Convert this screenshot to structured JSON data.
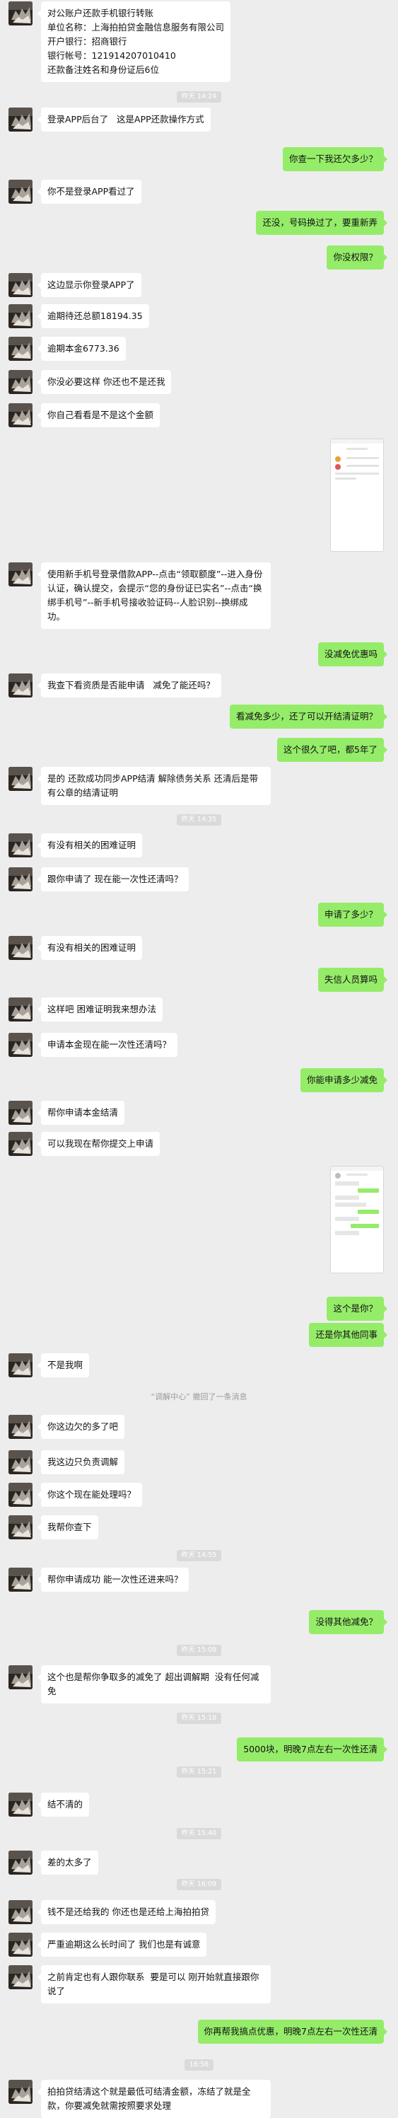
{
  "messages": [
    {
      "kind": "left",
      "text": "对公账户还款手机银行转账\n单位名称：上海拍拍贷金融信息服务有限公司\n开户银行：招商银行\n银行帐号：121914207010410\n还款备注姓名和身份证后6位"
    },
    {
      "kind": "time",
      "text": "昨天 14:24"
    },
    {
      "kind": "left",
      "text": "登录APP后台了   这是APP还款操作方式"
    },
    {
      "kind": "right",
      "text": "你查一下我还欠多少？"
    },
    {
      "kind": "left",
      "text": "你不是登录APP看过了"
    },
    {
      "kind": "right",
      "text": "还没，号码换过了，要重新弄"
    },
    {
      "kind": "right",
      "text": "你没权限？"
    },
    {
      "kind": "left",
      "text": "这边显示你登录APP了"
    },
    {
      "kind": "left",
      "text": "逾期待还总额18194.35"
    },
    {
      "kind": "left",
      "text": "逾期本金6773.36"
    },
    {
      "kind": "left",
      "text": "你没必要这样 你还也不是还我"
    },
    {
      "kind": "left",
      "text": "你自己看看是不是这个金额"
    },
    {
      "kind": "image",
      "variant": "app-account"
    },
    {
      "kind": "left",
      "text": "使用新手机号登录借款APP--点击“领取额度”--进入身份认证，确认提交，会提示“您的身份证已实名”--点击“换绑手机号”--新手机号接收验证码--人脸识别--换绑成功。"
    },
    {
      "kind": "right",
      "text": "没减免优惠吗"
    },
    {
      "kind": "left",
      "text": "我查下看资质是否能申请   减免了能还吗？"
    },
    {
      "kind": "right",
      "text": "看减免多少，还了可以开结清证明？"
    },
    {
      "kind": "right",
      "text": "这个很久了吧，都5年了"
    },
    {
      "kind": "left",
      "text": "是的 还款成功同步APP结清 解除债务关系 还清后是带有公章的结清证明"
    },
    {
      "kind": "time",
      "text": "昨天 14:35"
    },
    {
      "kind": "left",
      "text": "有没有相关的困难证明"
    },
    {
      "kind": "left",
      "text": "跟你申请了 现在能一次性还清吗？"
    },
    {
      "kind": "right",
      "text": "申请了多少？"
    },
    {
      "kind": "left",
      "text": "有没有相关的困难证明"
    },
    {
      "kind": "right",
      "text": "失信人员算吗"
    },
    {
      "kind": "left",
      "text": "这样吧 困难证明我来想办法"
    },
    {
      "kind": "left",
      "text": "申请本金现在能一次性还清吗？"
    },
    {
      "kind": "right",
      "text": "你能申请多少减免"
    },
    {
      "kind": "left",
      "text": "帮你申请本金结清"
    },
    {
      "kind": "left",
      "text": "可以我现在帮你提交上申请"
    },
    {
      "kind": "image",
      "variant": "chat-screenshot"
    },
    {
      "kind": "right",
      "text": "这个是你？"
    },
    {
      "kind": "right",
      "text": "还是你其他同事"
    },
    {
      "kind": "left",
      "text": "不是我啊"
    },
    {
      "kind": "notice",
      "text": "“调解中心” 撤回了一条消息"
    },
    {
      "kind": "left",
      "text": "你这边欠的多了吧"
    },
    {
      "kind": "left",
      "text": "我这边只负责调解"
    },
    {
      "kind": "left",
      "text": "你这个现在能处理吗？"
    },
    {
      "kind": "left",
      "text": "我帮你查下"
    },
    {
      "kind": "time",
      "text": "昨天 14:55"
    },
    {
      "kind": "left",
      "text": "帮你申请成功 能一次性还进来吗？"
    },
    {
      "kind": "right",
      "text": "没得其他减免？"
    },
    {
      "kind": "time",
      "text": "昨天 15:08"
    },
    {
      "kind": "left",
      "text": "这个也是帮你争取多的减免了 超出调解期  没有任何减免"
    },
    {
      "kind": "time",
      "text": "昨天 15:18"
    },
    {
      "kind": "right",
      "text": "5000块，明晚7点左右一次性还清"
    },
    {
      "kind": "time",
      "text": "昨天 15:21"
    },
    {
      "kind": "left",
      "text": "结不清的"
    },
    {
      "kind": "time",
      "text": "昨天 15:40"
    },
    {
      "kind": "left",
      "text": "差的太多了"
    },
    {
      "kind": "time",
      "text": "昨天 16:09"
    },
    {
      "kind": "left",
      "text": "钱不是还给我的 你还也是还给上海拍拍贷"
    },
    {
      "kind": "left",
      "text": "严重逾期这么长时间了 我们也是有诚意"
    },
    {
      "kind": "left",
      "text": "之前肯定也有人跟你联系  要是可以 刚开始就直接跟你说了"
    },
    {
      "kind": "right",
      "text": "你再帮我搞点优惠，明晚7点左右一次性还清"
    },
    {
      "kind": "time",
      "text": "16:56"
    },
    {
      "kind": "left",
      "text": "拍拍贷结清这个就是最低可结清金额，冻结了就是全款，你要减免就需按照要求处理"
    }
  ]
}
